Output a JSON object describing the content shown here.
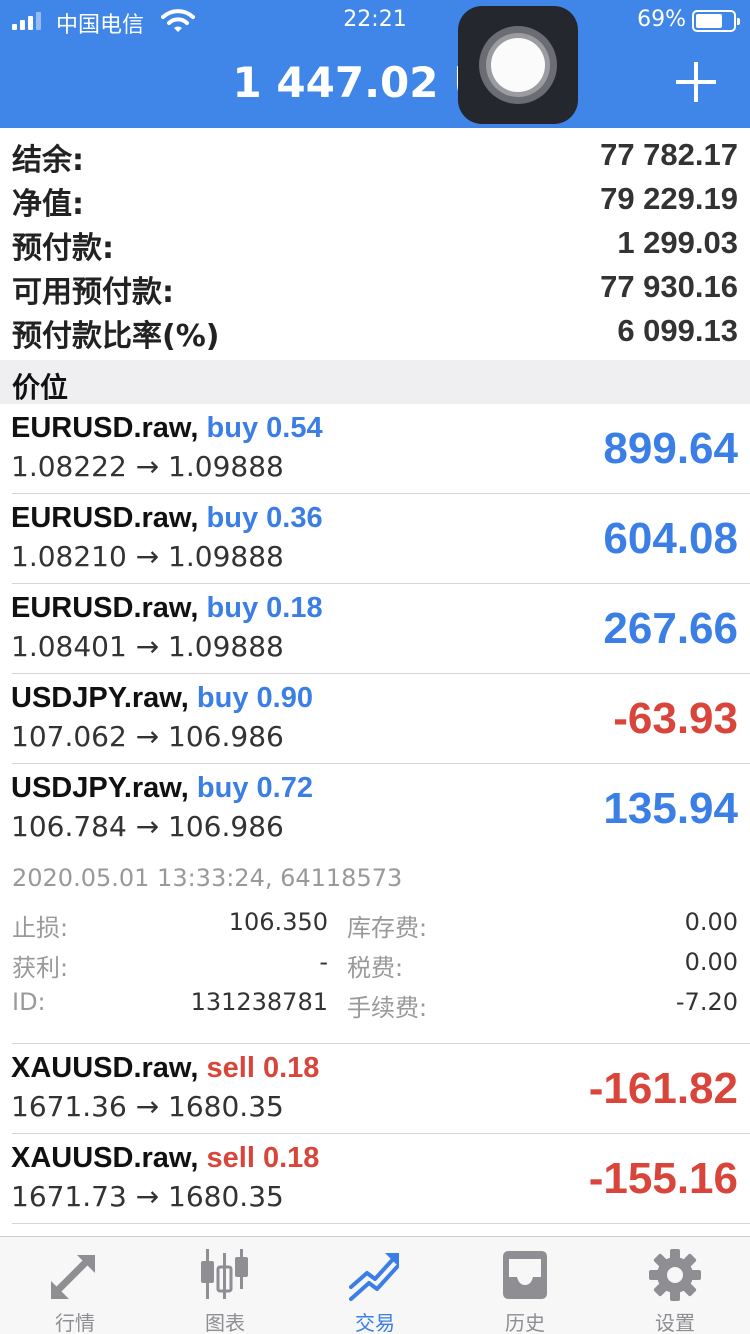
{
  "status_bar": {
    "carrier": "中国电信",
    "time": "22:21",
    "battery": "69%",
    "battery_level": 0.69
  },
  "header": {
    "title": "1 447.02 US"
  },
  "summary": [
    {
      "label": "结余:",
      "value": "77 782.17"
    },
    {
      "label": "净值:",
      "value": "79 229.19"
    },
    {
      "label": "预付款:",
      "value": "1 299.03"
    },
    {
      "label": "可用预付款:",
      "value": "77 930.16"
    },
    {
      "label": "预付款比率(%)",
      "value": "6 099.13"
    }
  ],
  "section_title": "价位",
  "positions": [
    {
      "symbol": "EURUSD.raw,",
      "side": "buy 0.54",
      "prices": "1.08222 → 1.09888",
      "profit": "899.64"
    },
    {
      "symbol": "EURUSD.raw,",
      "side": "buy 0.36",
      "prices": "1.08210 → 1.09888",
      "profit": "604.08"
    },
    {
      "symbol": "EURUSD.raw,",
      "side": "buy 0.18",
      "prices": "1.08401 → 1.09888",
      "profit": "267.66"
    },
    {
      "symbol": "USDJPY.raw,",
      "side": "buy 0.90",
      "prices": "107.062 → 106.986",
      "profit": "-63.93"
    },
    {
      "symbol": "USDJPY.raw,",
      "side": "buy 0.72",
      "prices": "106.784 → 106.986",
      "profit": "135.94"
    },
    {
      "symbol": "XAUUSD.raw,",
      "side": "sell 0.18",
      "prices": "1671.36 → 1680.35",
      "profit": "-161.82"
    },
    {
      "symbol": "XAUUSD.raw,",
      "side": "sell 0.18",
      "prices": "1671.73 → 1680.35",
      "profit": "-155.16"
    }
  ],
  "detail": {
    "timestamp": "2020.05.01 13:33:24, 64118573",
    "rows": [
      {
        "k1": "止损:",
        "v1": "106.350",
        "k2": "库存费:",
        "v2": "0.00"
      },
      {
        "k1": "获利:",
        "v1": "-",
        "k2": "税费:",
        "v2": "0.00"
      },
      {
        "k1": "ID:",
        "v1": "131238781",
        "k2": "手续费:",
        "v2": "-7.20"
      }
    ]
  },
  "tabs": [
    {
      "label": "行情",
      "icon": "quotes-arrows-icon"
    },
    {
      "label": "图表",
      "icon": "chart-candles-icon"
    },
    {
      "label": "交易",
      "icon": "trade-trend-icon",
      "active": true
    },
    {
      "label": "历史",
      "icon": "history-inbox-icon"
    },
    {
      "label": "设置",
      "icon": "settings-gear-icon"
    }
  ],
  "colors": {
    "header": "#3f86e8",
    "profit": "#3a7ee6",
    "loss": "#d9453a"
  }
}
